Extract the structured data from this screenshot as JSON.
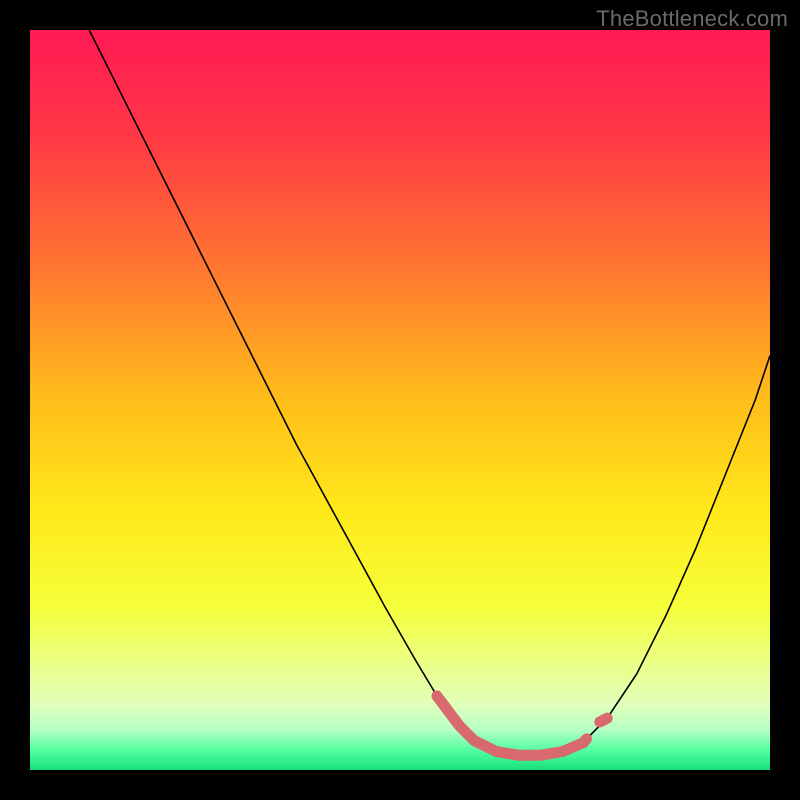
{
  "attribution": "TheBottleneck.com",
  "chart_data": {
    "type": "line",
    "title": "",
    "xlabel": "",
    "ylabel": "",
    "xlim": [
      0,
      100
    ],
    "ylim": [
      0,
      100
    ],
    "grid": false,
    "legend": false,
    "background_gradient": {
      "stops": [
        {
          "offset": 0.0,
          "color": "#ff1a55"
        },
        {
          "offset": 0.14,
          "color": "#ff3745"
        },
        {
          "offset": 0.33,
          "color": "#ff7a2f"
        },
        {
          "offset": 0.5,
          "color": "#ffbd1a"
        },
        {
          "offset": 0.65,
          "color": "#ffe91a"
        },
        {
          "offset": 0.78,
          "color": "#f5ff3a"
        },
        {
          "offset": 0.86,
          "color": "#eaff8a"
        },
        {
          "offset": 0.91,
          "color": "#e1ffba"
        },
        {
          "offset": 0.945,
          "color": "#b8ffc4"
        },
        {
          "offset": 0.975,
          "color": "#4dff9d"
        },
        {
          "offset": 1.0,
          "color": "#18e07a"
        }
      ]
    },
    "series": [
      {
        "name": "bottleneck-curve",
        "stroke": "#000000",
        "stroke_width": 1.6,
        "x": [
          8,
          12,
          18,
          24,
          30,
          36,
          42,
          48,
          52,
          55,
          58,
          60,
          63,
          66,
          69,
          72,
          75,
          78,
          82,
          86,
          90,
          94,
          98,
          100
        ],
        "y": [
          100,
          92,
          80,
          68,
          56,
          44,
          33,
          22,
          15,
          10,
          6,
          4,
          2.5,
          2,
          2,
          2.5,
          4,
          7,
          13,
          21,
          30,
          40,
          50,
          56
        ]
      },
      {
        "name": "bottleneck-valley-highlight",
        "stroke": "#d86a6f",
        "stroke_width": 11,
        "linecap": "round",
        "x": [
          55,
          58,
          60,
          63,
          66,
          69,
          72,
          74.8,
          75.2,
          77,
          78
        ],
        "y": [
          10,
          6,
          4,
          2.5,
          2,
          2,
          2.5,
          3.7,
          4.2,
          6.5,
          7
        ]
      }
    ]
  }
}
